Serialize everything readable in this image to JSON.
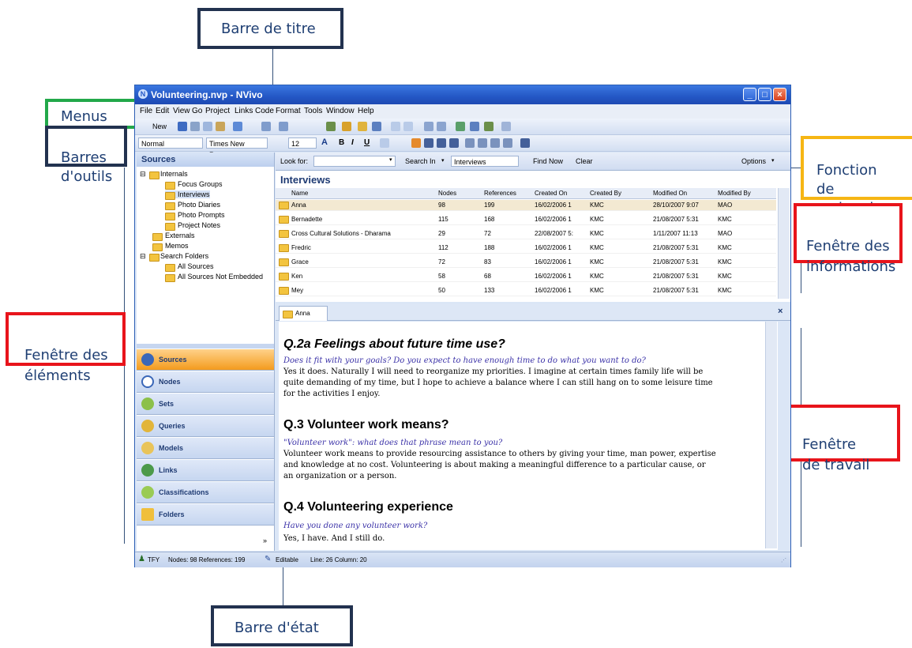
{
  "annotations": {
    "title_bar": "Barre de titre",
    "menus": "Menus",
    "toolbars": "Barres\nd'outils",
    "search": "Fonction\nde\nrecherche",
    "info_window": "Fenêtre des\ninformations",
    "elements_window": "Fenêtre des\néléments",
    "work_window": "Fenêtre\nde travail",
    "status_bar": "Barre d'état"
  },
  "window": {
    "title": "Volunteering.nvp - NVivo",
    "menus": [
      "File",
      "Edit",
      "View",
      "Go",
      "Project",
      "Links",
      "Code",
      "Format",
      "Tools",
      "Window",
      "Help"
    ],
    "toolbar1": {
      "new_label": "New"
    },
    "toolbar2": {
      "style": "Normal",
      "font": "Times New Roman",
      "size": "12"
    }
  },
  "sources_panel": {
    "title": "Sources",
    "tree": [
      {
        "label": "Internals",
        "level": 0
      },
      {
        "label": "Focus Groups",
        "level": 1
      },
      {
        "label": "Interviews",
        "level": 1
      },
      {
        "label": "Photo Diaries",
        "level": 1
      },
      {
        "label": "Photo Prompts",
        "level": 1
      },
      {
        "label": "Project Notes",
        "level": 1
      },
      {
        "label": "Externals",
        "level": 0
      },
      {
        "label": "Memos",
        "level": 0
      },
      {
        "label": "Search Folders",
        "level": 0
      },
      {
        "label": "All Sources",
        "level": 1
      },
      {
        "label": "All Sources Not Embedded",
        "level": 1
      }
    ],
    "nav": [
      "Sources",
      "Nodes",
      "Sets",
      "Queries",
      "Models",
      "Links",
      "Classifications",
      "Folders"
    ]
  },
  "findbar": {
    "look_for_label": "Look for:",
    "look_for_value": "",
    "search_in_label": "Search In",
    "search_in_value": "Interviews",
    "find_now": "Find Now",
    "clear": "Clear",
    "options": "Options"
  },
  "list": {
    "title": "Interviews",
    "columns": [
      "Name",
      "Nodes",
      "References",
      "Created On",
      "Created By",
      "Modified On",
      "Modified By"
    ],
    "rows": [
      [
        "Anna",
        "98",
        "199",
        "16/02/2006 1",
        "KMC",
        "28/10/2007 9:07",
        "MAO"
      ],
      [
        "Bernadette",
        "115",
        "168",
        "16/02/2006 1",
        "KMC",
        "21/08/2007 5:31",
        "KMC"
      ],
      [
        "Cross Cultural Solutions - Dharama",
        "29",
        "72",
        "22/08/2007 5:",
        "KMC",
        "1/11/2007 11:13",
        "MAO"
      ],
      [
        "Fredric",
        "112",
        "188",
        "16/02/2006 1",
        "KMC",
        "21/08/2007 5:31",
        "KMC"
      ],
      [
        "Grace",
        "72",
        "83",
        "16/02/2006 1",
        "KMC",
        "21/08/2007 5:31",
        "KMC"
      ],
      [
        "Ken",
        "58",
        "68",
        "16/02/2006 1",
        "KMC",
        "21/08/2007 5:31",
        "KMC"
      ],
      [
        "Mey",
        "50",
        "133",
        "16/02/2006 1",
        "KMC",
        "21/08/2007 5:31",
        "KMC"
      ]
    ]
  },
  "detail": {
    "tab": "Anna",
    "sections": [
      {
        "heading": "Q.2a Feelings about future time use?",
        "prompt": "Does it fit with your goals? Do you expect to have enough time to do what you want to do?",
        "body": "Yes it does. Naturally I will need to reorganize my priorities. I imagine at certain times family life will be quite demanding of my time, but I hope to achieve a balance where I can still hang on to some leisure time for the activities I enjoy."
      },
      {
        "heading": "Q.3 Volunteer work means?",
        "prompt": "\"Volunteer work\": what does that phrase mean to you?",
        "body": "Volunteer work means to provide resourcing assistance to others by giving your time, man power, expertise and knowledge at no cost. Volunteering is about making a meaningful difference to a particular cause, or an organization or a person."
      },
      {
        "heading": "Q.4 Volunteering experience",
        "prompt": "Have you done any volunteer work?",
        "body": "Yes, I have. And I still do."
      }
    ]
  },
  "status": {
    "user": "TFY",
    "nodes_refs": "Nodes: 98  References: 199",
    "editable": "Editable",
    "line_col": "Line: 26 Column: 20"
  },
  "colors": {
    "annotation_navy": "#22324f",
    "annotation_green": "#22a84a",
    "annotation_red": "#e8141b",
    "annotation_yellow": "#f6b614",
    "title_blue": "#2457c5",
    "active_nav": "#f39b1e"
  }
}
